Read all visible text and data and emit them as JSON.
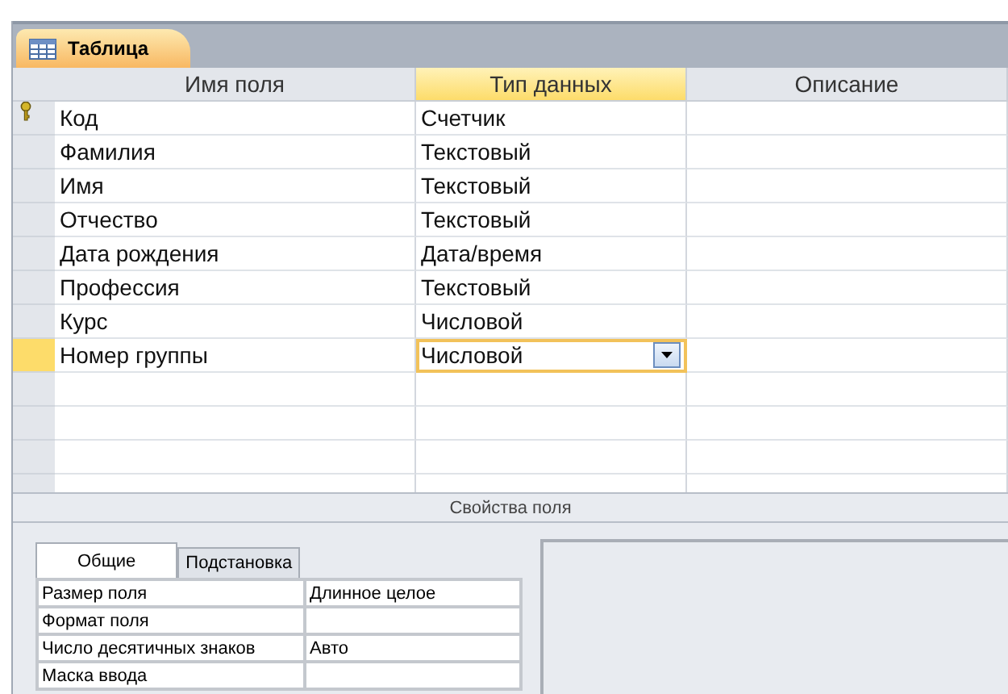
{
  "document_tab": {
    "title": "Таблица",
    "selected": true
  },
  "columns": [
    {
      "label": "Имя поля",
      "selected": false
    },
    {
      "label": "Тип данных",
      "selected": true
    },
    {
      "label": "Описание",
      "selected": false
    }
  ],
  "rows": [
    {
      "name": "Код",
      "type": "Счетчик",
      "primary_key": true,
      "selected": false
    },
    {
      "name": "Фамилия",
      "type": "Текстовый",
      "primary_key": false,
      "selected": false
    },
    {
      "name": "Имя",
      "type": "Текстовый",
      "primary_key": false,
      "selected": false
    },
    {
      "name": "Отчество",
      "type": "Текстовый",
      "primary_key": false,
      "selected": false
    },
    {
      "name": "Дата рождения",
      "type": "Дата/время",
      "primary_key": false,
      "selected": false
    },
    {
      "name": "Профессия",
      "type": "Текстовый",
      "primary_key": false,
      "selected": false
    },
    {
      "name": "Курс",
      "type": "Числовой",
      "primary_key": false,
      "selected": false
    },
    {
      "name": "Номер группы",
      "type": "Числовой",
      "primary_key": false,
      "selected": true
    }
  ],
  "properties_title": "Свойства поля",
  "property_tabs": [
    {
      "label": "Общие",
      "selected": true
    },
    {
      "label": "Подстановка",
      "selected": false
    }
  ],
  "properties": [
    {
      "name": "Размер поля",
      "value": "Длинное целое"
    },
    {
      "name": "Формат поля"
    },
    {
      "name": "Число десятичных знаков",
      "value": "Авто"
    },
    {
      "name": "Маска ввода"
    }
  ]
}
